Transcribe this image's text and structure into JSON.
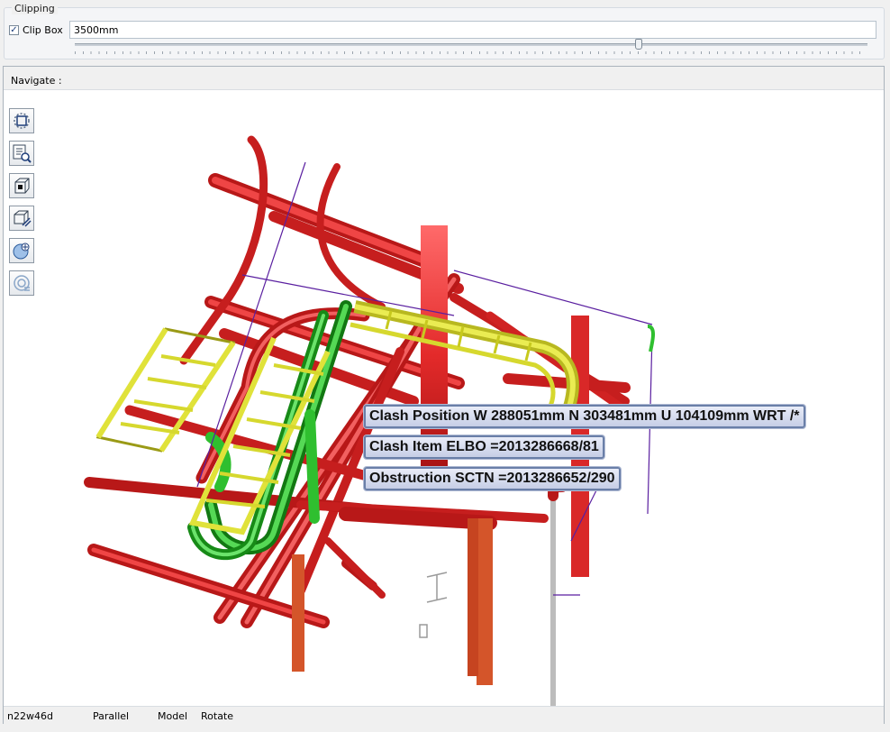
{
  "clipping": {
    "group_title": "Clipping",
    "clip_box_label": "Clip Box",
    "clip_box_checked": true,
    "clip_value": "3500mm",
    "slider_fraction": 0.71
  },
  "navigate": {
    "label": "Navigate :"
  },
  "toolbar": {
    "icons": [
      "zoom-region-icon",
      "zoom-to-selection-icon",
      "view-box-icon",
      "clip-volume-icon",
      "sphere-orbit-icon",
      "pick-target-icon"
    ]
  },
  "viewport": {
    "clash_position": "Clash Position W 288051mm N 303481mm U 104109mm WRT /*",
    "clash_item": "Clash Item ELBO =2013286668/81",
    "obstruction": "Obstruction SCTN =2013286652/290",
    "colors": {
      "steel": "#e32a2a",
      "tray": "#e0e23a",
      "pipe": "#2fbf2f",
      "support": "#d4552a",
      "background": "#ffffff"
    }
  },
  "status": {
    "element": "n22w46d",
    "projection": "Parallel",
    "mode": "Model",
    "action": "Rotate"
  }
}
